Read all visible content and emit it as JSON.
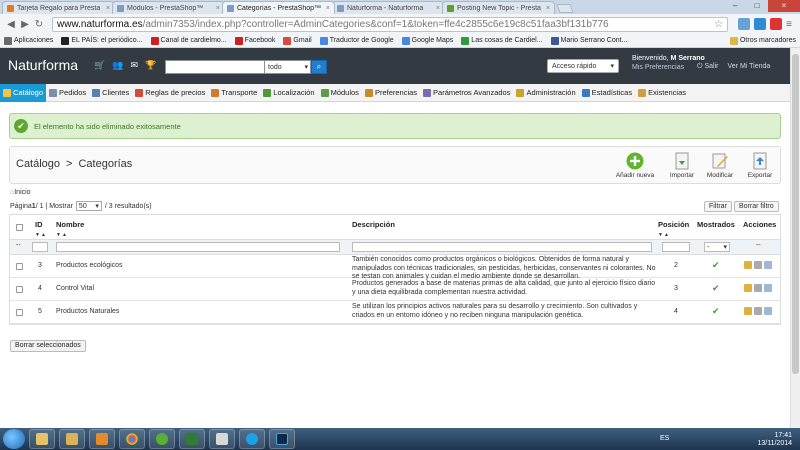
{
  "browser": {
    "tabs": [
      {
        "label": "Tarjeta Regalo para Presta",
        "color": "#e37b1d",
        "active": false
      },
      {
        "label": "Módulos - PrestaShop™",
        "color": "#7a9cc6",
        "active": false
      },
      {
        "label": "Categorías - PrestaShop™",
        "color": "#7a9cc6",
        "active": true
      },
      {
        "label": "Naturforma - Naturforma",
        "color": "#7a9cc6",
        "active": false
      },
      {
        "label": "Posting New Topic - Presta",
        "color": "#5aa02c",
        "active": false
      }
    ],
    "url_host": "www.naturforma.es",
    "url_path": "/admin7353/index.php?controller=AdminCategories&conf=1&token=ffe4c2855c6e19c8c51faa3bf131b776",
    "bookmarks": [
      {
        "label": "Aplicaciones",
        "color": "#6a6a6a"
      },
      {
        "label": "EL PAÍS: el periódico...",
        "color": "#222222"
      },
      {
        "label": "Canal de cardielmo...",
        "color": "#d02020"
      },
      {
        "label": "Facebook",
        "color": "#d02020"
      },
      {
        "label": "Gmail",
        "color": "#d64b3c"
      },
      {
        "label": "Traductor de Google",
        "color": "#4a86e8"
      },
      {
        "label": "Google Maps",
        "color": "#4a86e8"
      },
      {
        "label": "Las cosas de Cardiel...",
        "color": "#2e9c3a"
      },
      {
        "label": "Mario Serrano Cont...",
        "color": "#3b5998"
      }
    ],
    "other_bookmarks": "Otros marcadores"
  },
  "header": {
    "brand": "Naturforma",
    "search_scope": "todo",
    "quick_access": "Acceso rápido",
    "welcome": "Bienvenido,",
    "user": "M Serrano",
    "preferences": "Mis Preferencias",
    "logout": "Salir",
    "view_store": "Ver Mi Tienda"
  },
  "menu": [
    {
      "label": "Catálogo",
      "color": "#f6c24a",
      "active": true
    },
    {
      "label": "Pedidos",
      "color": "#7a8fa6",
      "active": false
    },
    {
      "label": "Clientes",
      "color": "#5a7fb8",
      "active": false
    },
    {
      "label": "Reglas de precios",
      "color": "#d24a3a",
      "active": false
    },
    {
      "label": "Transporte",
      "color": "#d27a2a",
      "active": false
    },
    {
      "label": "Localización",
      "color": "#4a9a3a",
      "active": false
    },
    {
      "label": "Módulos",
      "color": "#5aa04a",
      "active": false
    },
    {
      "label": "Preferencias",
      "color": "#c98a2a",
      "active": false
    },
    {
      "label": "Parámetros Avanzados",
      "color": "#7a6ab0",
      "active": false
    },
    {
      "label": "Administración",
      "color": "#c9a32a",
      "active": false
    },
    {
      "label": "Estadísticas",
      "color": "#3a7ac0",
      "active": false
    },
    {
      "label": "Existencias",
      "color": "#d0a040",
      "active": false
    }
  ],
  "alert": {
    "message": "El elemento ha sido eliminado exitosamente"
  },
  "toolbar": {
    "breadcrumb_parent": "Catálogo",
    "breadcrumb_sep": ">",
    "breadcrumb_current": "Categorías",
    "add_new": "Añadir nueva",
    "import": "Importar",
    "edit": "Modificar",
    "export": "Exportar"
  },
  "home_link": "Inicio",
  "pager": {
    "prefix": "Página ",
    "current": "1",
    "suffix": " / 1 | Mostrar",
    "per_page": "50",
    "results": "/ 3 resultado(s)"
  },
  "filter_button": "Filtrar",
  "reset_filter_button": "Borrar filtro",
  "table": {
    "columns": {
      "id": "ID",
      "name": "Nombre",
      "description": "Descripción",
      "position": "Posición",
      "displayed": "Mostrados",
      "actions": "Acciones"
    },
    "sort_glyph": "▼▲",
    "filter_placeholder": "--",
    "displayed_filter": "-",
    "actions_filter": "--",
    "rows": [
      {
        "id": "3",
        "name": "Productos ecológicos",
        "description": "También conocidos como productos orgánicos o biológicos. Obtenidos de forma natural y manipulados con técnicas tradicionales, sin pesticidas, herbicidas, conservantes ni colorantes. No se testan con animales y cuidan el medio ambiente donde se desarrollan.",
        "position": "2",
        "displayed": "✔"
      },
      {
        "id": "4",
        "name": "Control Vital",
        "description": "Productos generados a base de materias primas de alta calidad, que junto al ejercicio físico diario y una dieta equilibrada complementan nuestra actividad.",
        "position": "3",
        "displayed": "✔"
      },
      {
        "id": "5",
        "name": "Productos Naturales",
        "description": "Se utilizan los principios activos naturales para su desarrollo y crecimiento. Son cultivados y criados en un entorno idóneo y no reciben ninguna manipulación genética.",
        "position": "4",
        "displayed": "✔"
      }
    ]
  },
  "bulk_delete": "Borrar seleccionados",
  "taskbar": {
    "language": "ES",
    "time": "17:41",
    "date": "13/11/2014"
  }
}
